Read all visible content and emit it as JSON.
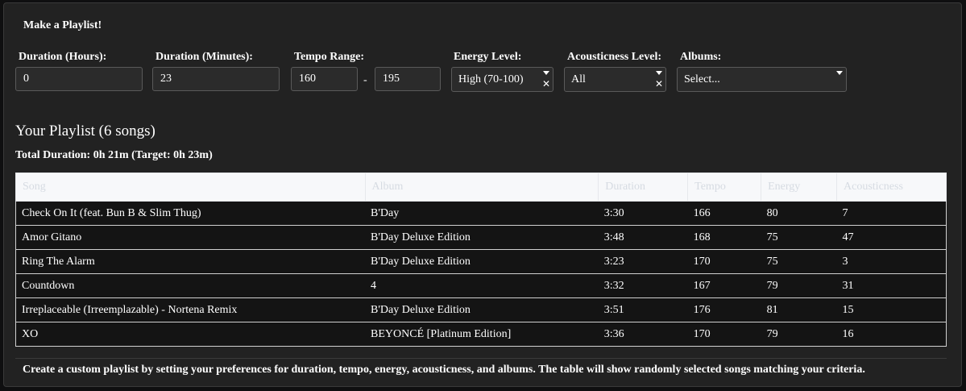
{
  "app": {
    "title": "Make a Playlist!"
  },
  "controls": {
    "duration_hours": {
      "label": "Duration (Hours):",
      "value": "0"
    },
    "duration_minutes": {
      "label": "Duration (Minutes):",
      "value": "23"
    },
    "tempo_range": {
      "label": "Tempo Range:",
      "min": "160",
      "separator": "-",
      "max": "195"
    },
    "energy_level": {
      "label": "Energy Level:",
      "selected": "High (70-100)"
    },
    "acousticness_level": {
      "label": "Acousticness Level:",
      "selected": "All"
    },
    "albums": {
      "label": "Albums:",
      "placeholder": "Select..."
    },
    "icons": {
      "dropdown": "caret-down-icon",
      "clear": "close-icon"
    }
  },
  "playlist": {
    "heading": "Your Playlist (6 songs)",
    "total_duration": "Total Duration: 0h 21m (Target: 0h 23m)",
    "columns": [
      "Song",
      "Album",
      "Duration",
      "Tempo",
      "Energy",
      "Acousticness"
    ],
    "rows": [
      [
        "Check On It (feat. Bun B & Slim Thug)",
        "B'Day",
        "3:30",
        "166",
        "80",
        "7"
      ],
      [
        "Amor Gitano",
        "B'Day Deluxe Edition",
        "3:48",
        "168",
        "75",
        "47"
      ],
      [
        "Ring The Alarm",
        "B'Day Deluxe Edition",
        "3:23",
        "170",
        "75",
        "3"
      ],
      [
        "Countdown",
        "4",
        "3:32",
        "167",
        "79",
        "31"
      ],
      [
        "Irreplaceable (Irreemplazable) - Nortena Remix",
        "B'Day Deluxe Edition",
        "3:51",
        "176",
        "81",
        "15"
      ],
      [
        "XO",
        "BEYONCÉ [Platinum Edition]",
        "3:36",
        "170",
        "79",
        "16"
      ]
    ]
  },
  "footer": {
    "text": "Create a custom playlist by setting your preferences for duration, tempo, energy, acousticness, and albums. The table will show randomly selected songs matching your criteria."
  },
  "colors": {
    "background": "#222222",
    "input_background": "#2b2b2b",
    "table_header_background": "#f7f8fa",
    "table_row_background": "#141414"
  }
}
